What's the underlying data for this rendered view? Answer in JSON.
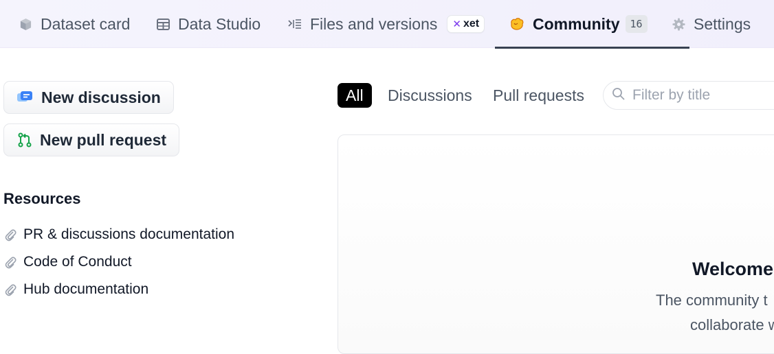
{
  "tabs": [
    {
      "label": "Dataset card",
      "icon": "cube-icon"
    },
    {
      "label": "Data Studio",
      "icon": "table-icon"
    },
    {
      "label": "Files and versions",
      "icon": "files-icon",
      "badge": "xet"
    },
    {
      "label": "Community",
      "icon": "hugging-hand-icon",
      "count": "16",
      "active": true
    },
    {
      "label": "Settings",
      "icon": "gear-icon"
    }
  ],
  "sidebar": {
    "new_discussion_label": "New discussion",
    "new_pr_label": "New pull request",
    "resources_title": "Resources",
    "links": [
      "PR & discussions documentation",
      "Code of Conduct",
      "Hub documentation"
    ]
  },
  "filters": {
    "all": "All",
    "discussions": "Discussions",
    "pull_requests": "Pull requests"
  },
  "search": {
    "placeholder": "Filter by title"
  },
  "main": {
    "welcome_title": "Welcome",
    "desc_line1": "The community t",
    "desc_line2": "collaborate w"
  },
  "colors": {
    "accent_active": "#000000",
    "topbar_bg": "#f3f2fc",
    "pr_icon": "#16a34a",
    "discussion_icon": "#3b82f6"
  }
}
